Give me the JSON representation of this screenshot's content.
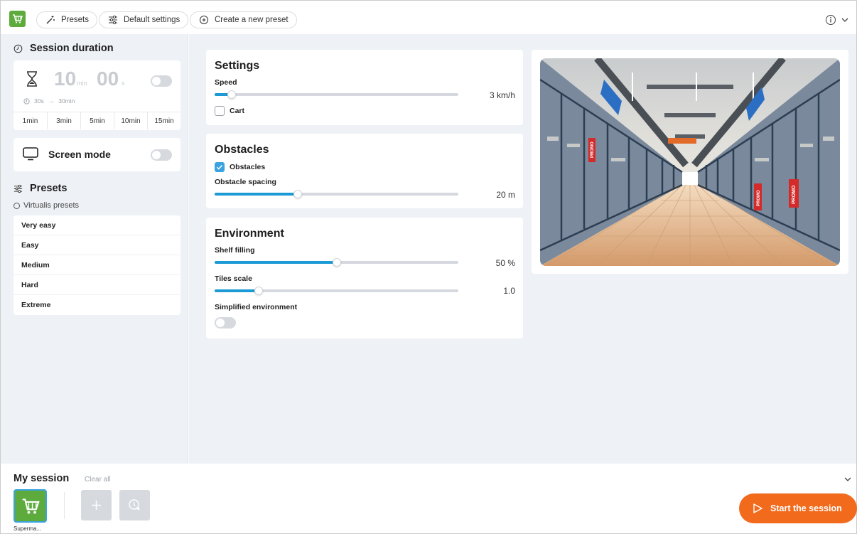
{
  "topbar": {
    "presets_label": "Presets",
    "default_settings_label": "Default settings",
    "create_preset_label": "Create a new preset"
  },
  "session_duration": {
    "title": "Session duration",
    "minutes": "10",
    "minutes_unit": "min",
    "seconds": "00",
    "seconds_unit": "s",
    "range_min": "30s",
    "range_arrow": "→",
    "range_max": "30min",
    "quick_times": [
      "1min",
      "3min",
      "5min",
      "10min",
      "15min"
    ]
  },
  "screen_mode": {
    "label": "Screen mode"
  },
  "presets": {
    "title": "Presets",
    "group_label": "Virtualis presets",
    "items": [
      "Very easy",
      "Easy",
      "Medium",
      "Hard",
      "Extreme"
    ]
  },
  "settings": {
    "title": "Settings",
    "speed_label": "Speed",
    "speed_value": "3 km/h",
    "speed_fraction": 0.07,
    "cart_label": "Cart"
  },
  "obstacles": {
    "title": "Obstacles",
    "obstacles_label": "Obstacles",
    "spacing_label": "Obstacle spacing",
    "spacing_value": "20 m",
    "spacing_fraction": 0.34
  },
  "environment": {
    "title": "Environment",
    "shelf_label": "Shelf filling",
    "shelf_value": "50 %",
    "shelf_fraction": 0.5,
    "tiles_label": "Tiles scale",
    "tiles_value": "1.0",
    "tiles_fraction": 0.18,
    "simplified_label": "Simplified environment"
  },
  "preview": {
    "sign_text": "PROMO"
  },
  "session": {
    "title": "My session",
    "clear_all": "Clear all",
    "item_label": "Superma...",
    "start_label": "Start the session"
  },
  "colors": {
    "accent": "#1b9ad6",
    "brand_green": "#5cab3c",
    "start_orange": "#f26a1b"
  }
}
